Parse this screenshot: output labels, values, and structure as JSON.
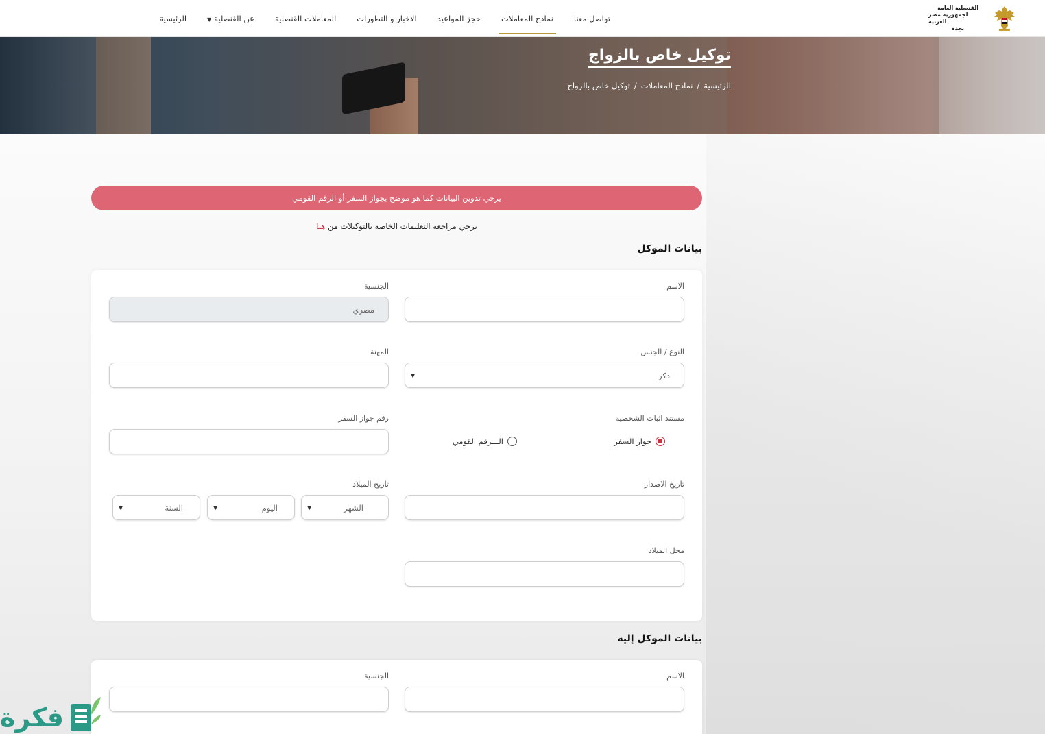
{
  "header": {
    "logo_lines": [
      "القنصلية العامة",
      "لجمهورية مصر العربية",
      "بجدة"
    ],
    "nav": [
      {
        "label": "الرئيسية",
        "active": false
      },
      {
        "label": "عن القنصلية",
        "active": false,
        "dropdown": true
      },
      {
        "label": "المعاملات القنصلية",
        "active": false
      },
      {
        "label": "الاخبار و التطورات",
        "active": false
      },
      {
        "label": "حجز المواعيد",
        "active": false
      },
      {
        "label": "نماذج المعاملات",
        "active": true
      },
      {
        "label": "تواصل معنا",
        "active": false
      }
    ],
    "accent_color": "#b79a3a"
  },
  "hero": {
    "title": "توكيل خاص بالزواج",
    "breadcrumb": [
      "الرئيسية",
      "/",
      "نماذج المعاملات",
      "/",
      "توكيل خاص بالزواج"
    ]
  },
  "alert": {
    "text": "يرجي تدوين البيانات كما هو موضح بجواز السفر أو الرقم القومي",
    "color": "#de6574"
  },
  "note": {
    "text": "يرجي مراجعة التعليمات الخاصة بالتوكيلات من",
    "link": "هنا"
  },
  "principal": {
    "title": "بيانات الموكل",
    "name_label": "الاسم",
    "name_value": "",
    "nationality_label": "الجنسية",
    "nationality_value": "مصري",
    "gender_label": "النوع / الجنس",
    "gender_value": "ذكر",
    "profession_label": "المهنة",
    "profession_value": "",
    "id_doc_label": "مستند اثبات الشخصية",
    "id_doc_options": [
      "جواز السفر",
      "الـــرقم القومي"
    ],
    "id_doc_selected": "جواز السفر",
    "passport_label": "رقم جواز السفر",
    "passport_value": "",
    "issue_date_label": "تاريخ الاصدار",
    "issue_date_value": "",
    "birth_date_label": "تاريخ الميلاد",
    "birth_month": "الشهر",
    "birth_day": "اليوم",
    "birth_year": "السنة",
    "birth_place_label": "محل الميلاد",
    "birth_place_value": ""
  },
  "agent": {
    "title": "بيانات الموكل إليه",
    "name_label": "الاسم",
    "name_value": "",
    "nationality_label": "الجنسية",
    "nationality_value": ""
  },
  "watermark": {
    "text": "فكرة",
    "color": "#2a9a86"
  }
}
